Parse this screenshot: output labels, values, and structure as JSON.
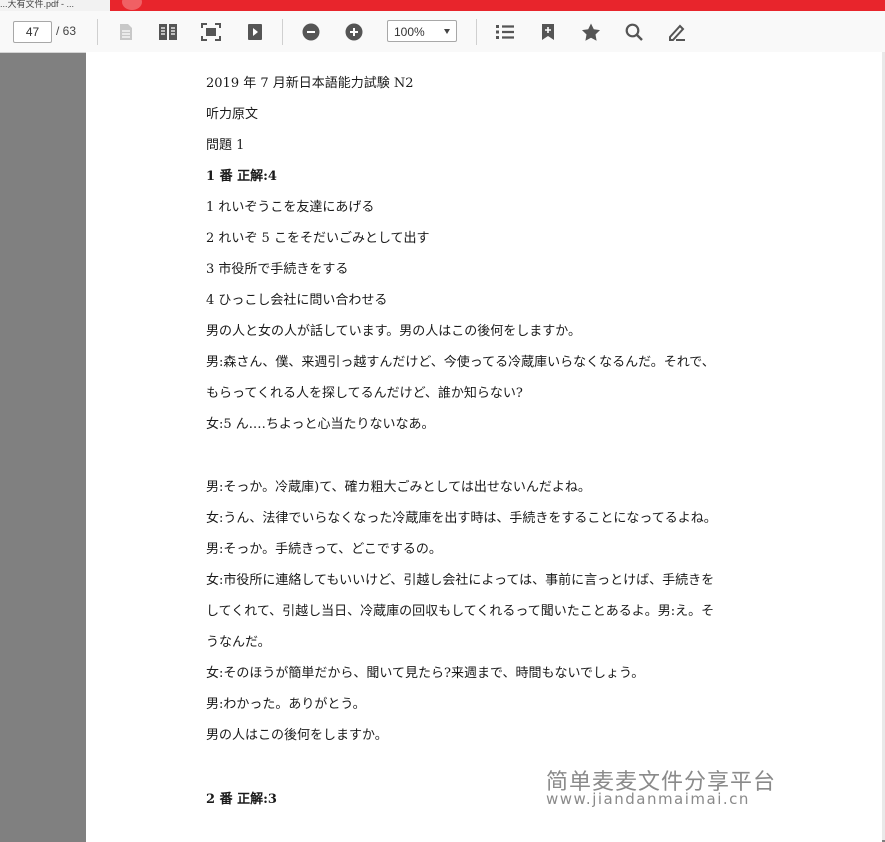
{
  "browser": {
    "tab_title": "...大有文件.pdf - ..."
  },
  "toolbar": {
    "current_page": "47",
    "total_pages": "/ 63",
    "zoom": "100%",
    "icons": [
      "page-icon",
      "dual-page-icon",
      "fit-page-icon",
      "play-icon",
      "zoom-out-icon",
      "zoom-in-icon",
      "list-icon",
      "bookmark-add-icon",
      "star-icon",
      "search-icon",
      "pen-icon"
    ]
  },
  "document": {
    "lines": [
      "2019 年 7 月新日本語能力試験 N2",
      "听力原文",
      "問題 1",
      "1 番  正解:4",
      "1 れいぞうこを友達にあげる",
      "2 れいぞ 5 こをそだいごみとして出す",
      "3 市役所で手続きをする",
      "4 ひっこし会社に問い合わせる",
      "男の人と女の人が話しています。男の人はこの後何をしますか。",
      "男:森さん、僕、来週引っ越すんだけど、今使ってる冷蔵庫いらなくなるんだ。それで、",
      "もらってくれる人を探してるんだけど、誰か知らない?",
      "女:5 ん.…ちよっと心当たりないなあ。",
      "男:そっか。冷蔵庫)て、確カ粗大ごみとしては出せないんだよね。",
      "女:うん、法律でいらなくなった冷蔵庫を出す時は、手続きをすることになってるよね。",
      "男:そっか。手続きって、どこでするの。",
      "女:市役所に連絡してもいいけど、引越し会社によっては、事前に言っとけば、手続きを",
      "してくれて、引越し当日、冷蔵庫の回収もしてくれるって聞いたことあるよ。男:え。そ",
      "うなんだ。",
      "女:そのほうが簡単だから、聞いて見たら?来週まで、時間もないでしょう。",
      "男:わかった。ありがとう。",
      "男の人はこの後何をしますか。",
      "2 番  正解:3"
    ],
    "watermark_cn": "简单麦麦文件分享平台",
    "watermark_url": "www.jiandanmaimai.cn"
  }
}
